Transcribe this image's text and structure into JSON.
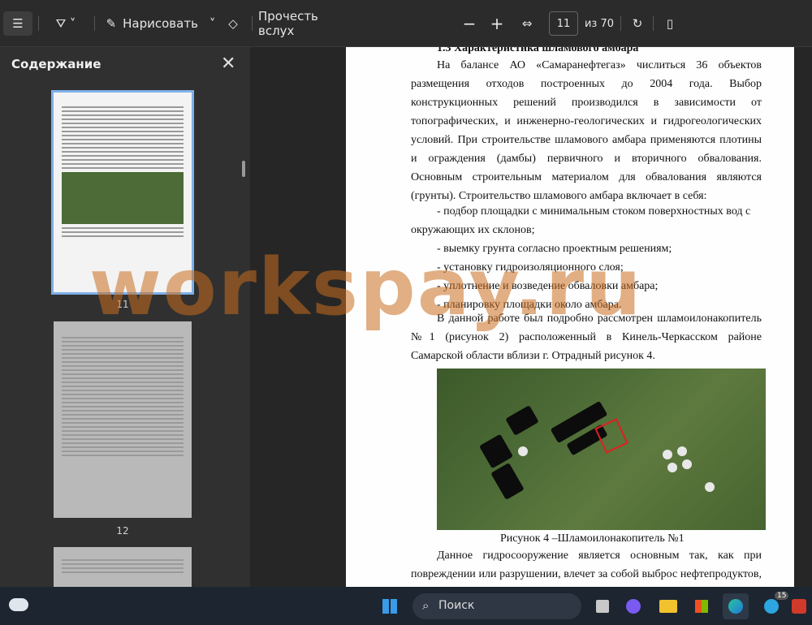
{
  "toolbar": {
    "draw_label": "Нарисовать",
    "read_aloud_label": "Прочесть вслух",
    "page_number": "11",
    "page_total": "из 70"
  },
  "sidebar": {
    "title": "Содержание",
    "thumbs": [
      "11",
      "12"
    ]
  },
  "page": {
    "heading": "1.3 Характеристика шламового амбара",
    "para1": "На балансе АО «Самаранефтегаз» числиться 36 объектов размещения отходов построенных до 2004 года. Выбор конструкционных решений производился в зависимости от топографических, и инженерно-геологических и гидрогеологических условий. При строительстве шламового амбара применяются плотины и ограждения (дамбы) первичного и вторичного обвалования. Основным строительным материалом для обвалования являются (грунты). Строительство шламового амбара включает в себя:",
    "list": [
      "- подбор площадки с минимальным стоком поверхностных вод с",
      "окружающих их склонов;",
      "- выемку грунта согласно проектным решениям;",
      "- установку гидроизоляционного слоя;",
      "- уплотнение и возведение обваловки амбара;",
      "- планировку площадки около амбара."
    ],
    "para2": "В данной работе был подробно рассмотрен шламоилонакопитель №1 (рисунок 2) расположенный в Кинель-Черкасском районе Самарской области вблизи  г. Отрадный рисунок 4.",
    "caption": "Рисунок 4 –Шламоилонакопитель №1",
    "para3": "Данное гидросооружение является основным так, как при повреждении или разрушении, влечет за собой выброс нефтепродуктов, что негативно"
  },
  "watermark": "workspay.ru",
  "taskbar": {
    "search_label": "Поиск",
    "badge": "15"
  }
}
